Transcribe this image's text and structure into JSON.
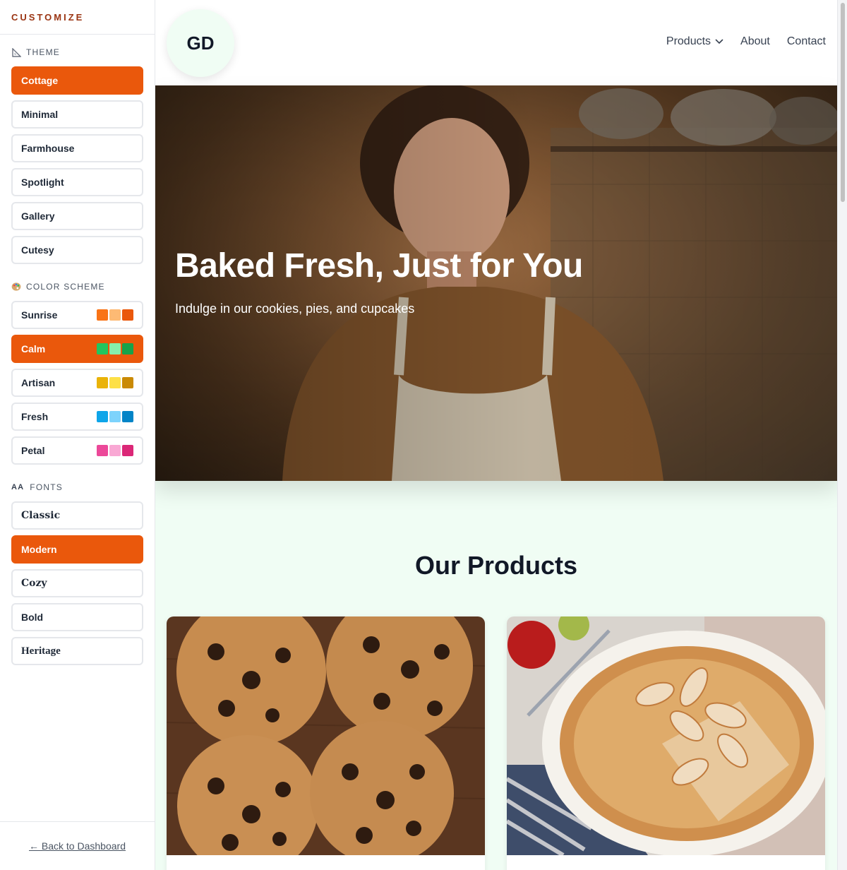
{
  "sidebar": {
    "title": "CUSTOMIZE",
    "theme": {
      "heading": "THEME",
      "options": [
        "Cottage",
        "Minimal",
        "Farmhouse",
        "Spotlight",
        "Gallery",
        "Cutesy"
      ],
      "selected": "Cottage"
    },
    "color_scheme": {
      "heading": "COLOR SCHEME",
      "options": [
        {
          "label": "Sunrise",
          "colors": [
            "#f97316",
            "#fdba74",
            "#ea580c"
          ]
        },
        {
          "label": "Calm",
          "colors": [
            "#22c55e",
            "#86efac",
            "#16a34a"
          ]
        },
        {
          "label": "Artisan",
          "colors": [
            "#eab308",
            "#fde047",
            "#ca8a04"
          ]
        },
        {
          "label": "Fresh",
          "colors": [
            "#0ea5e9",
            "#7dd3fc",
            "#0284c7"
          ]
        },
        {
          "label": "Petal",
          "colors": [
            "#ec4899",
            "#f9a8d4",
            "#db2777"
          ]
        }
      ],
      "selected": "Calm"
    },
    "fonts": {
      "heading_prefix": "AA",
      "heading": "FONTS",
      "options": [
        "Classic",
        "Modern",
        "Cozy",
        "Bold",
        "Heritage"
      ],
      "selected": "Modern"
    },
    "back_link": "← Back to Dashboard"
  },
  "header": {
    "logo": "GD",
    "nav": {
      "products": "Products",
      "about": "About",
      "contact": "Contact"
    }
  },
  "hero": {
    "title": "Baked Fresh, Just for You",
    "subtitle": "Indulge in our cookies, pies, and cupcakes"
  },
  "products": {
    "title": "Our Products"
  },
  "colors": {
    "accent": "#ea580c",
    "main_background": "#f0fdf4"
  }
}
